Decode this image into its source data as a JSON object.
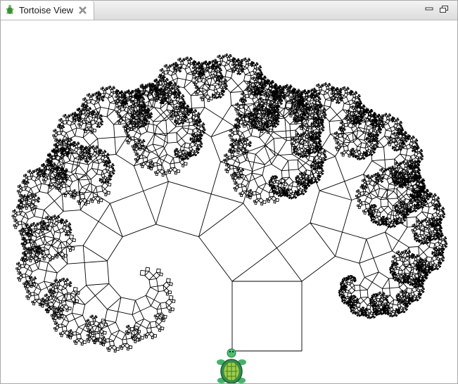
{
  "view": {
    "tab_title": "Tortoise View",
    "icons": {
      "tab": "tortoise-icon",
      "close": "close-icon",
      "minimize": "minimize-icon",
      "maximize": "maximize-icon",
      "turtle": "turtle-sprite"
    }
  },
  "drawing": {
    "type": "pythagoras-tree",
    "depth": 12,
    "left_angle_deg": 36.87,
    "stroke_color": "#000000",
    "background": "#ffffff"
  }
}
